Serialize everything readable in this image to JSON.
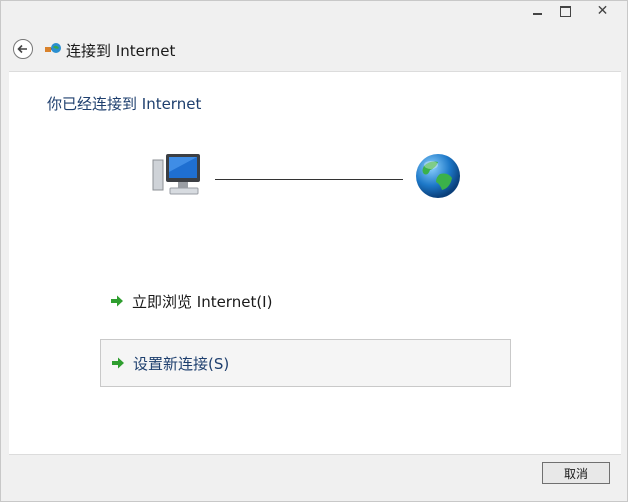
{
  "window": {
    "title": "连接到 Internet",
    "controls": {
      "minimize": "minimize",
      "maximize": "maximize",
      "close": "close"
    }
  },
  "content": {
    "heading": "你已经连接到 Internet",
    "commands": [
      {
        "label": "立即浏览 Internet(I)",
        "icon": "green-arrow-icon"
      },
      {
        "label": "设置新连接(S)",
        "icon": "green-arrow-icon"
      }
    ]
  },
  "footer": {
    "cancel_label": "取消"
  },
  "colors": {
    "heading": "#1e3f6e",
    "arrow": "#2f9e2f",
    "content_bg": "#ffffff",
    "window_bg": "#f0f0f0"
  }
}
